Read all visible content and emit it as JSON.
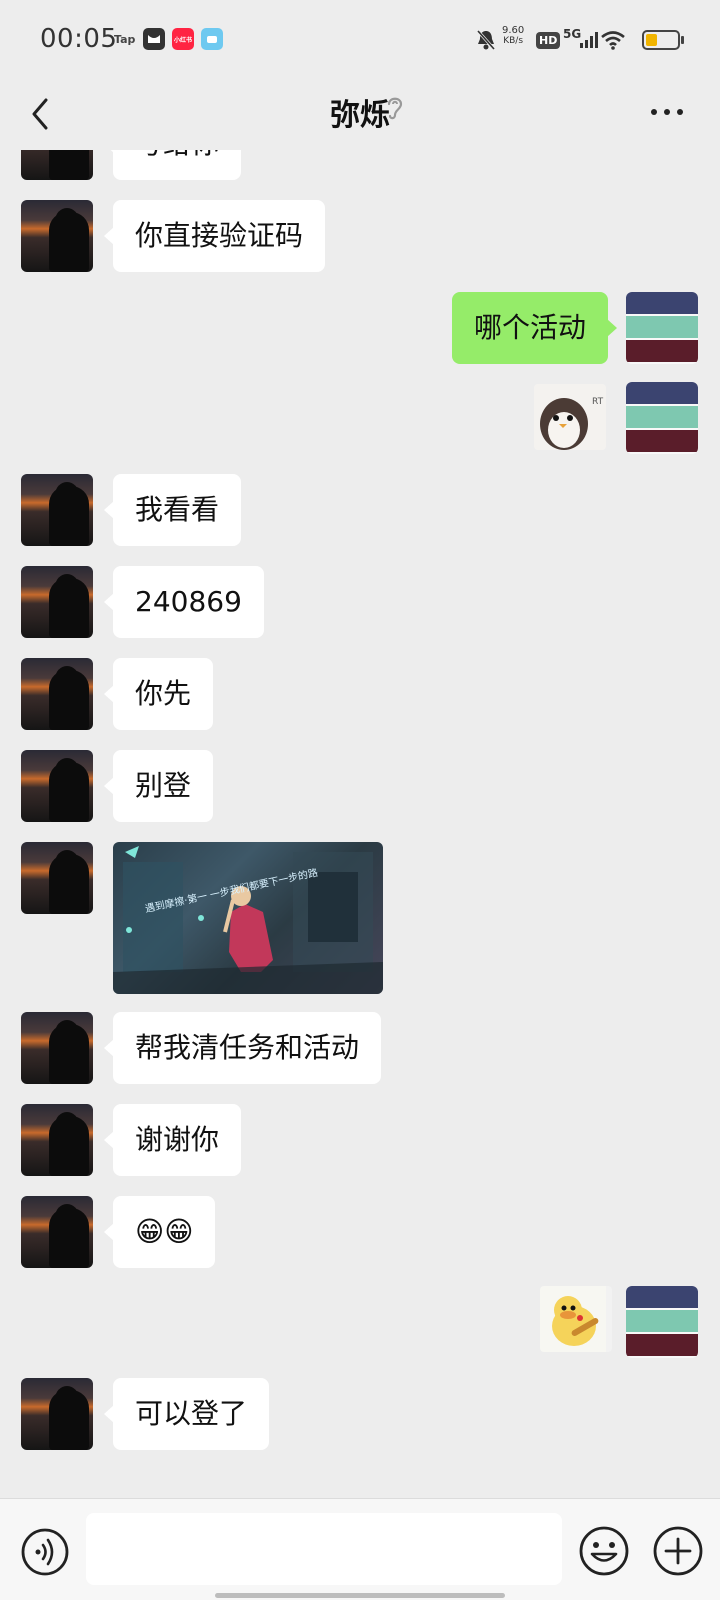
{
  "status_bar": {
    "time": "00:05",
    "apps": [
      "Tap",
      "小红书"
    ],
    "net_speed_value": "9.60",
    "net_speed_unit": "KB/s",
    "hd_label": "HD",
    "signal_label": "5G",
    "battery_level": 0.35,
    "battery_color": "#f0b400"
  },
  "nav": {
    "title": "弥烁"
  },
  "messages": [
    {
      "side": "in",
      "type": "text",
      "text": "号给你"
    },
    {
      "side": "in",
      "type": "text",
      "text": "你直接验证码"
    },
    {
      "side": "out",
      "type": "text",
      "text": "哪个活动"
    },
    {
      "side": "out",
      "type": "sticker",
      "sticker": "penguin-sticker",
      "text": "RT"
    },
    {
      "side": "in",
      "type": "text",
      "text": "我看看"
    },
    {
      "side": "in",
      "type": "text",
      "text": "240869"
    },
    {
      "side": "in",
      "type": "text",
      "text": "你先"
    },
    {
      "side": "in",
      "type": "text",
      "text": "别登"
    },
    {
      "side": "in",
      "type": "image",
      "caption": "遇到摩擦·第一 一步我们都要下一步的路"
    },
    {
      "side": "in",
      "type": "text",
      "text": "帮我清任务和活动"
    },
    {
      "side": "in",
      "type": "text",
      "text": "谢谢你"
    },
    {
      "side": "in",
      "type": "text",
      "text": "😁😁"
    },
    {
      "side": "out",
      "type": "sticker",
      "sticker": "duck-sticker"
    },
    {
      "side": "in",
      "type": "text",
      "text": "可以登了"
    }
  ],
  "input_bar": {
    "placeholder": ""
  },
  "colors": {
    "chat_bg": "#ededed",
    "incoming_bubble": "#ffffff",
    "outgoing_bubble": "#95ec69"
  }
}
